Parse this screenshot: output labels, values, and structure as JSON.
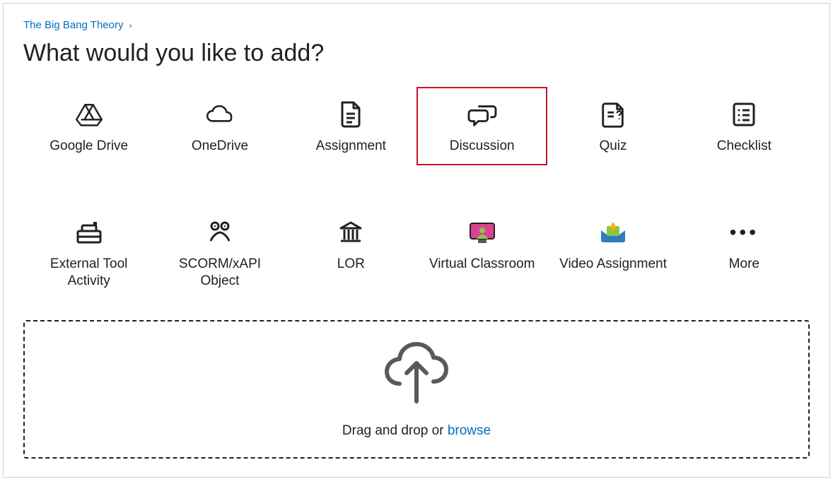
{
  "breadcrumb": {
    "course": "The Big Bang Theory"
  },
  "title": "What would you like to add?",
  "options": {
    "googledrive": {
      "label": "Google Drive"
    },
    "onedrive": {
      "label": "OneDrive"
    },
    "assignment": {
      "label": "Assignment"
    },
    "discussion": {
      "label": "Discussion"
    },
    "quiz": {
      "label": "Quiz"
    },
    "checklist": {
      "label": "Checklist"
    },
    "externaltool": {
      "label": "External Tool Activity"
    },
    "scorm": {
      "label": "SCORM/xAPI Object"
    },
    "lor": {
      "label": "LOR"
    },
    "virtual": {
      "label": "Virtual Classroom"
    },
    "videoassign": {
      "label": "Video Assignment"
    },
    "more": {
      "label": "More"
    }
  },
  "dropzone": {
    "text_prefix": "Drag and drop or ",
    "browse": "browse"
  }
}
